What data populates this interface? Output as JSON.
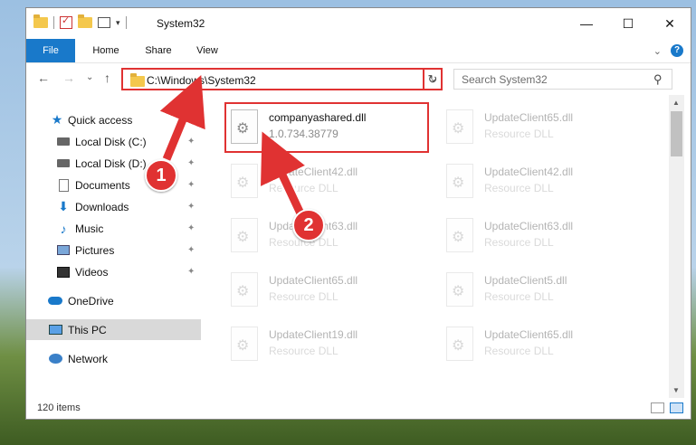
{
  "window": {
    "title": "System32",
    "minimize_glyph": "—",
    "maximize_glyph": "☐",
    "close_glyph": "✕",
    "qat_dropdown_glyph": "▾"
  },
  "ribbon": {
    "tabs": [
      "File",
      "Home",
      "Share",
      "View"
    ],
    "collapse_glyph": "⌄",
    "help_glyph": "?"
  },
  "nav": {
    "back_glyph": "←",
    "forward_glyph": "→",
    "recent_glyph": "⌄",
    "up_glyph": "↑",
    "address": "C:\\Windows\\System32",
    "address_dropdown_glyph": "⌄",
    "refresh_glyph": "↻",
    "search_placeholder": "Search System32",
    "search_glyph": "⚲"
  },
  "sidebar": {
    "items": [
      {
        "label": "Quick access",
        "icon": "star-icon"
      },
      {
        "label": "Local Disk (C:)",
        "icon": "drive-icon"
      },
      {
        "label": "Local Disk (D:)",
        "icon": "drive-icon"
      },
      {
        "label": "Documents",
        "icon": "documents-icon"
      },
      {
        "label": "Downloads",
        "icon": "downloads-icon"
      },
      {
        "label": "Music",
        "icon": "music-icon"
      },
      {
        "label": "Pictures",
        "icon": "pictures-icon"
      },
      {
        "label": "Videos",
        "icon": "videos-icon"
      },
      {
        "label": "OneDrive",
        "icon": "onedrive-icon"
      },
      {
        "label": "This PC",
        "icon": "this-pc-icon"
      },
      {
        "label": "Network",
        "icon": "network-icon"
      }
    ],
    "pin_glyph": "📌"
  },
  "files": [
    {
      "name": "companyashared.dll",
      "desc": "1.0.734.38779"
    },
    {
      "name": "UpdateClient65.dll",
      "desc": "Resource DLL"
    },
    {
      "name": "UpdateClient42.dll",
      "desc": "Resource DLL"
    },
    {
      "name": "UpdateClient42.dll",
      "desc": "Resource DLL"
    },
    {
      "name": "UpdateClient63.dll",
      "desc": "Resource DLL"
    },
    {
      "name": "UpdateClient63.dll",
      "desc": "Resource DLL"
    },
    {
      "name": "UpdateClient65.dll",
      "desc": "Resource DLL"
    },
    {
      "name": "UpdateClient5.dll",
      "desc": "Resource DLL"
    },
    {
      "name": "UpdateClient19.dll",
      "desc": "Resource DLL"
    },
    {
      "name": "UpdateClient65.dll",
      "desc": "Resource DLL"
    }
  ],
  "status": {
    "item_count": "120 items"
  },
  "scrollbar": {
    "up_glyph": "▲",
    "down_glyph": "▼"
  },
  "callouts": [
    "1",
    "2"
  ],
  "colors": {
    "accent": "#1979ca",
    "highlight": "#e03232"
  }
}
